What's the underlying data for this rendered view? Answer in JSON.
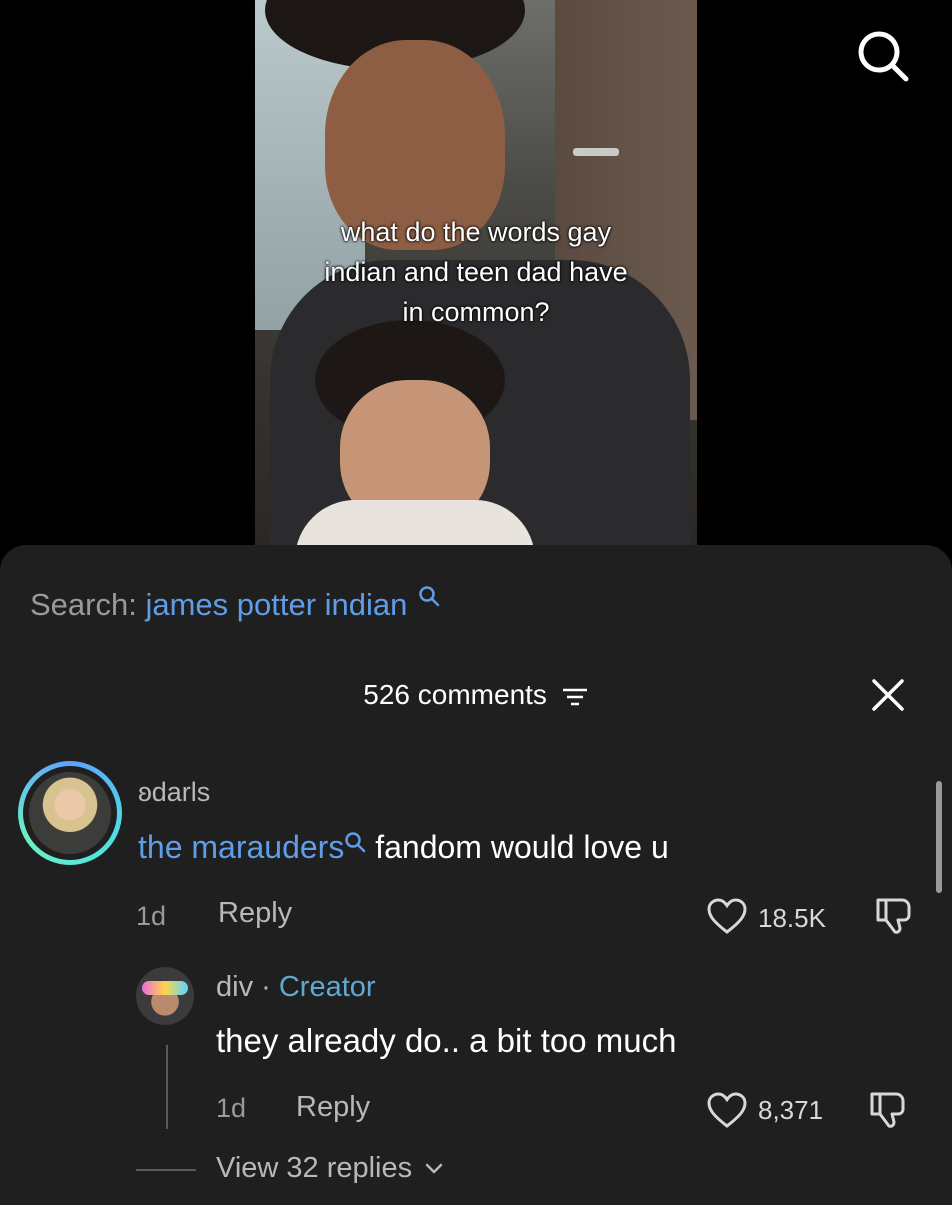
{
  "video": {
    "caption_line1": "what do the words gay",
    "caption_line2": "indian and teen dad have",
    "caption_line3": "in common?"
  },
  "search": {
    "label": "Search:",
    "term": "james potter indian"
  },
  "comments_header": {
    "count": "526 comments"
  },
  "comment1": {
    "username": "ʚdarls",
    "link_text": "the marauders",
    "text": " fandom would love u",
    "time": "1d",
    "reply": "Reply",
    "likes": "18.5K"
  },
  "comment2": {
    "username": "div",
    "separator": " · ",
    "creator": "Creator",
    "text": "they already do.. a bit too much",
    "time": "1d",
    "reply": "Reply",
    "likes": "8,371"
  },
  "view_replies": "View 32 replies",
  "colors": {
    "link_blue": "#5f9de8",
    "creator_blue": "#5fa8d3",
    "sheet_bg": "#1f1f1f"
  },
  "icons": [
    "search-icon",
    "filter-icon",
    "close-icon",
    "heart-icon",
    "dislike-icon",
    "chevron-down-icon"
  ]
}
